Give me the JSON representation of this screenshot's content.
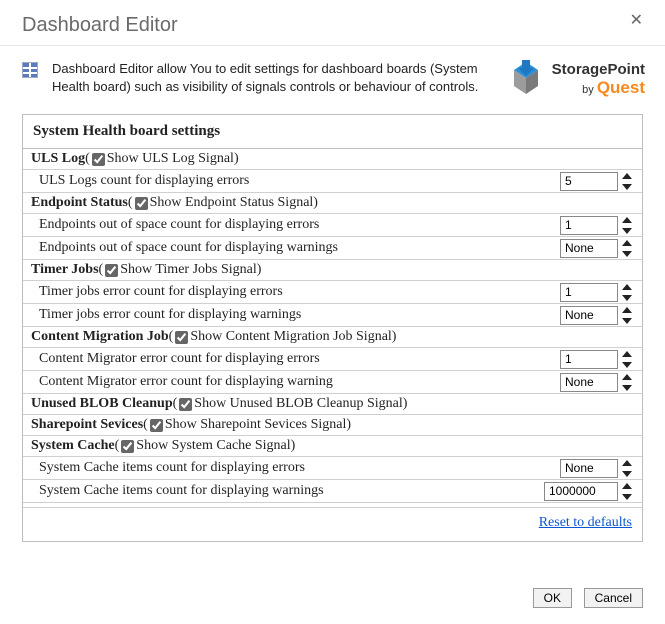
{
  "dialog": {
    "title": "Dashboard Editor",
    "intro": "Dashboard Editor allow You to edit settings for dashboard boards (System Health board) such as visibility of signals controls or behaviour of controls.",
    "panel_title": "System Health board settings",
    "reset_link": "Reset to defaults"
  },
  "brand": {
    "product": "StoragePoint",
    "by": "by",
    "vendor": "Quest"
  },
  "sections": {
    "uls": {
      "title": "ULS Log",
      "checkbox_label": "Show ULS Log Signal",
      "checked": true,
      "rows": {
        "errors": {
          "label": "ULS Logs count for displaying errors",
          "value": "5"
        }
      }
    },
    "endpoint": {
      "title": "Endpoint Status",
      "checkbox_label": "Show Endpoint Status Signal",
      "checked": true,
      "rows": {
        "errors": {
          "label": "Endpoints out of space count for displaying errors",
          "value": "1"
        },
        "warnings": {
          "label": "Endpoints out of space count for displaying warnings",
          "value": "None"
        }
      }
    },
    "timer": {
      "title": "Timer Jobs",
      "checkbox_label": "Show Timer Jobs Signal",
      "checked": true,
      "rows": {
        "errors": {
          "label": "Timer jobs error count for displaying errors",
          "value": "1"
        },
        "warnings": {
          "label": "Timer jobs error count for displaying warnings",
          "value": "None"
        }
      }
    },
    "migration": {
      "title": "Content Migration Job",
      "checkbox_label": "Show Content Migration Job Signal",
      "checked": true,
      "rows": {
        "errors": {
          "label": "Content Migrator error count for displaying errors",
          "value": "1"
        },
        "warnings": {
          "label": "Content Migrator error count for displaying warning",
          "value": "None"
        }
      }
    },
    "blob": {
      "title": "Unused BLOB Cleanup",
      "checkbox_label": "Show Unused BLOB Cleanup Signal",
      "checked": true
    },
    "sps": {
      "title": "Sharepoint Sevices",
      "checkbox_label": "Show Sharepoint Sevices Signal",
      "checked": true
    },
    "cache": {
      "title": "System Cache",
      "checkbox_label": "Show System Cache Signal",
      "checked": true,
      "rows": {
        "errors": {
          "label": "System Cache items count for displaying errors",
          "value": "None"
        },
        "warnings": {
          "label": "System Cache items count for displaying warnings",
          "value": "1000000"
        }
      }
    }
  },
  "buttons": {
    "ok": "OK",
    "cancel": "Cancel"
  }
}
